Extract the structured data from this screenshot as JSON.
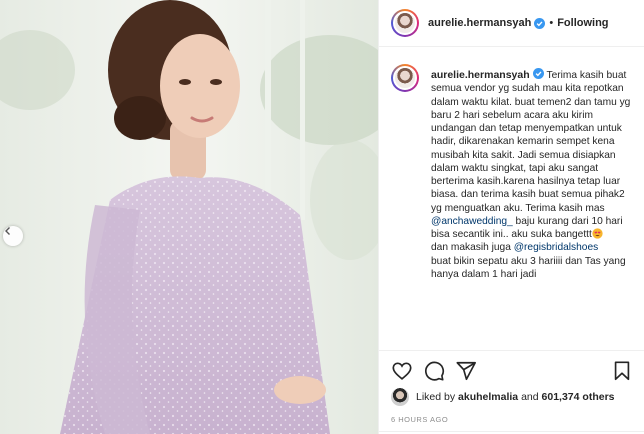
{
  "header": {
    "username": "aurelie.hermansyah",
    "separator": "•",
    "follow_label": "Following"
  },
  "caption": {
    "username": "aurelie.hermansyah",
    "text_1": "Terima kasih buat semua vendor yg sudah mau kita repotkan dalam waktu kilat. buat temen2 dan tamu yg baru 2 hari sebelum acara aku kirim undangan dan tetap menyempatkan untuk hadir, dikarenakan kemarin sempet kena musibah kita sakit. Jadi semua disiapkan dalam waktu singkat, tapi aku sangat berterima kasih.karena hasilnya tetap luar biasa. dan terima kasih buat semua pihak2 yg menguatkan aku. Terima kasih mas",
    "mention_1": "@anchawedding_",
    "text_2": " baju kurang dari 10 hari bisa secantik ini.. aku suka bangettt",
    "text_3": "dan makasih juga",
    "mention_2": "@regisbridalshoes",
    "text_4": "buat bikin sepatu aku 3 hariiii dan Tas yang hanya dalam 1 hari jadi"
  },
  "likes": {
    "prefix": "Liked by",
    "user": "akuhelmalia",
    "and": "and",
    "count": "601,374 others"
  },
  "timestamp": "6 HOURS AGO",
  "icons": {
    "verified": "verified-badge-icon",
    "like": "heart-icon",
    "comment": "comment-icon",
    "share": "paper-plane-icon",
    "save": "bookmark-icon",
    "prev": "chevron-left-icon",
    "emoji": "heart-eyes-emoji"
  },
  "colors": {
    "verified": "#3897f0",
    "mention": "#00376b",
    "muted": "#8e8e8e",
    "text": "#262626"
  }
}
